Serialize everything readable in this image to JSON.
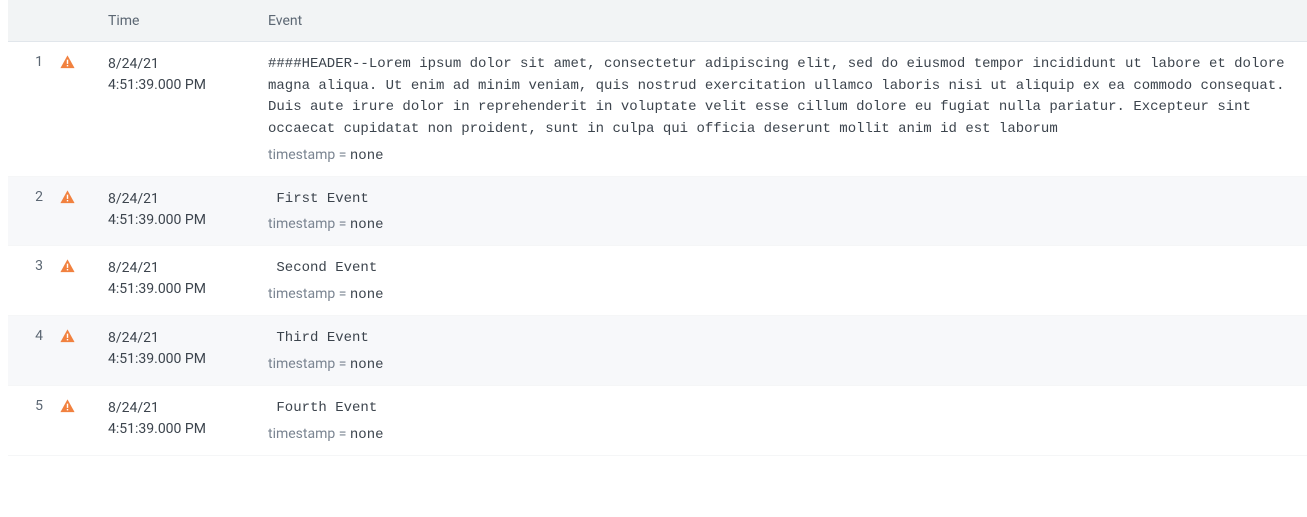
{
  "columns": {
    "time": "Time",
    "event": "Event"
  },
  "meta_label": "timestamp",
  "rows": [
    {
      "num": "1",
      "date": "8/24/21",
      "clock": "4:51:39.000 PM",
      "event": "####HEADER--Lorem ipsum dolor sit amet, consectetur adipiscing elit, sed do eiusmod tempor incididunt ut labore et dolore magna aliqua. Ut enim ad minim veniam, quis nostrud exercitation ullamco laboris nisi ut aliquip ex ea commodo consequat. Duis aute irure dolor in reprehenderit in voluptate velit esse cillum dolore eu fugiat nulla pariatur. Excepteur sint occaecat cupidatat non proident, sunt in culpa qui officia deserunt mollit anim id est laborum",
      "timestamp": "none"
    },
    {
      "num": "2",
      "date": "8/24/21",
      "clock": "4:51:39.000 PM",
      "event": " First Event",
      "timestamp": "none"
    },
    {
      "num": "3",
      "date": "8/24/21",
      "clock": "4:51:39.000 PM",
      "event": " Second Event",
      "timestamp": "none"
    },
    {
      "num": "4",
      "date": "8/24/21",
      "clock": "4:51:39.000 PM",
      "event": " Third Event",
      "timestamp": "none"
    },
    {
      "num": "5",
      "date": "8/24/21",
      "clock": "4:51:39.000 PM",
      "event": " Fourth Event",
      "timestamp": "none"
    }
  ]
}
